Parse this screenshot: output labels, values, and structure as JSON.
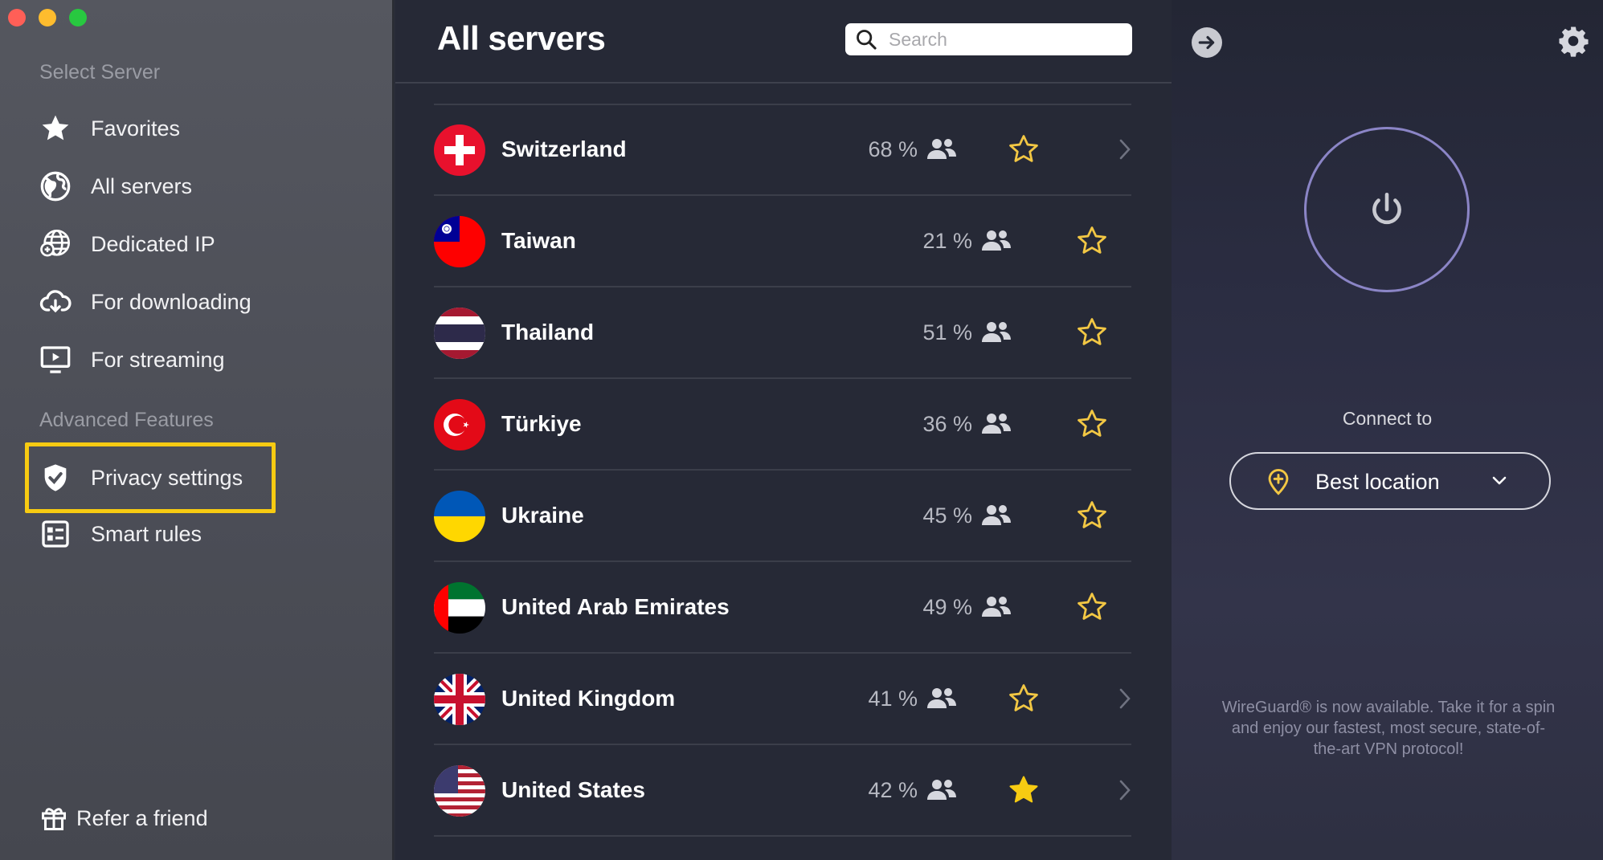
{
  "sidebar": {
    "section_select": "Select Server",
    "items": [
      {
        "label": "Favorites",
        "icon": "star-icon"
      },
      {
        "label": "All servers",
        "icon": "globe-icon"
      },
      {
        "label": "Dedicated IP",
        "icon": "dedicated-ip-globe-icon"
      },
      {
        "label": "For downloading",
        "icon": "cloud-download-icon"
      },
      {
        "label": "For streaming",
        "icon": "play-screen-icon"
      }
    ],
    "section_advanced": "Advanced Features",
    "advanced_items": [
      {
        "label": "Privacy settings",
        "icon": "shield-check-icon",
        "highlighted": true
      },
      {
        "label": "Smart rules",
        "icon": "smart-rules-icon"
      }
    ],
    "refer_label": "Refer a friend",
    "highlight_color": "#f7cb12"
  },
  "list": {
    "title": "All servers",
    "search_placeholder": "Search",
    "rows": [
      {
        "country": "Switzerland",
        "load": "68 %",
        "favorite": false,
        "has_chevron": true
      },
      {
        "country": "Taiwan",
        "load": "21 %",
        "favorite": false,
        "has_chevron": false
      },
      {
        "country": "Thailand",
        "load": "51 %",
        "favorite": false,
        "has_chevron": false
      },
      {
        "country": "Türkiye",
        "load": "36 %",
        "favorite": false,
        "has_chevron": false
      },
      {
        "country": "Ukraine",
        "load": "45 %",
        "favorite": false,
        "has_chevron": false
      },
      {
        "country": "United Arab Emirates",
        "load": "49 %",
        "favorite": false,
        "has_chevron": false
      },
      {
        "country": "United Kingdom",
        "load": "41 %",
        "favorite": false,
        "has_chevron": true
      },
      {
        "country": "United States",
        "load": "42 %",
        "favorite": true,
        "has_chevron": true
      }
    ]
  },
  "right": {
    "connect_label": "Connect to",
    "location_label": "Best location",
    "notice": "WireGuard® is now available. Take it for a spin and enjoy our fastest, most secure, state-of-the-art VPN protocol!",
    "accent": "#8b85c6",
    "star_color": "#f2c744"
  }
}
